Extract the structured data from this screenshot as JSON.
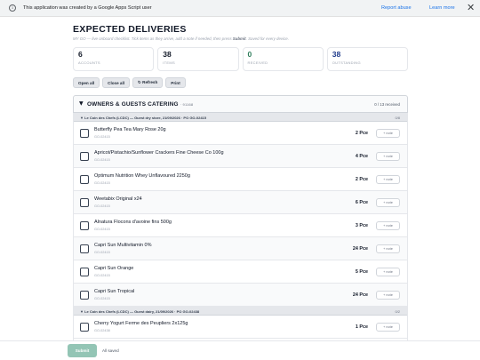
{
  "gas_bar": {
    "message": "This application was created by a Google Apps Script user",
    "report_abuse": "Report abuse",
    "learn_more": "Learn more",
    "info_icon": "info-icon",
    "close_icon": "close-icon"
  },
  "page": {
    "title": "EXPECTED DELIVERIES",
    "subtitle_pre": "MY GO — live onboard checklist. Tick items as they arrive, add a note if needed, then press ",
    "subtitle_bold": "Submit",
    "subtitle_post": ". Saved for every device."
  },
  "stats": [
    {
      "value": "6",
      "label": "ACCOUNTS"
    },
    {
      "value": "38",
      "label": "ITEMS"
    },
    {
      "value": "0",
      "label": "RECEIVED"
    },
    {
      "value": "38",
      "label": "OUTSTANDING"
    }
  ],
  "toolbar": {
    "open_all": "Open all",
    "close_all": "Close all",
    "refresh": "↻ Refresh",
    "print": "Print"
  },
  "owner": {
    "name": "OWNERS & GUESTS CATERING",
    "code": "· 91168",
    "received": "0 / 13 received"
  },
  "orders": [
    {
      "header": "▼ Le Coin des Chefs (LCDC) — Guest dry store, 21/09/2026 · PO GO-02415",
      "count": "0/8",
      "items": [
        {
          "name": "Butterfly Pea Tea Mary Rose 20g",
          "po": "GO-02415",
          "qty": "2 Pce",
          "note": "+ note"
        },
        {
          "name": "Apricot/Pistachio/Sunflower Crackers Fine Cheese Co 100g",
          "po": "GO-02415",
          "qty": "4 Pce",
          "note": "+ note"
        },
        {
          "name": "Optimum Nutrition Whey Unflavoured 2250g",
          "po": "GO-02415",
          "qty": "2 Pce",
          "note": "+ note"
        },
        {
          "name": "Weetabix Original x24",
          "po": "GO-02415",
          "qty": "6 Pce",
          "note": "+ note"
        },
        {
          "name": "Alnatura Flocons d'avoine fins 500g",
          "po": "GO-02415",
          "qty": "3 Pce",
          "note": "+ note"
        },
        {
          "name": "Capri Sun Multivitamin 0%",
          "po": "GO-02415",
          "qty": "24 Pce",
          "note": "+ note"
        },
        {
          "name": "Capri Sun Orange",
          "po": "GO-02415",
          "qty": "5 Pce",
          "note": "+ note"
        },
        {
          "name": "Capri Sun Tropical",
          "po": "GO-02415",
          "qty": "24 Pce",
          "note": "+ note"
        }
      ]
    },
    {
      "header": "▼ Le Coin des Chefs (LCDC) — Guest dairy, 21/09/2026 · PO GO-02438",
      "count": "0/2",
      "items": [
        {
          "name": "Cherry Yogurt Ferme des Peupliers 2x125g",
          "po": "GO-02438",
          "qty": "1 Pce",
          "note": "+ note"
        }
      ]
    }
  ],
  "footer": {
    "submit": "Submit",
    "status": "All saved"
  },
  "colors": {
    "accent_green": "#2f7d5b",
    "accent_blue": "#1e3a8a",
    "submit_bg": "#93c5b5",
    "link": "#1a73e8"
  }
}
